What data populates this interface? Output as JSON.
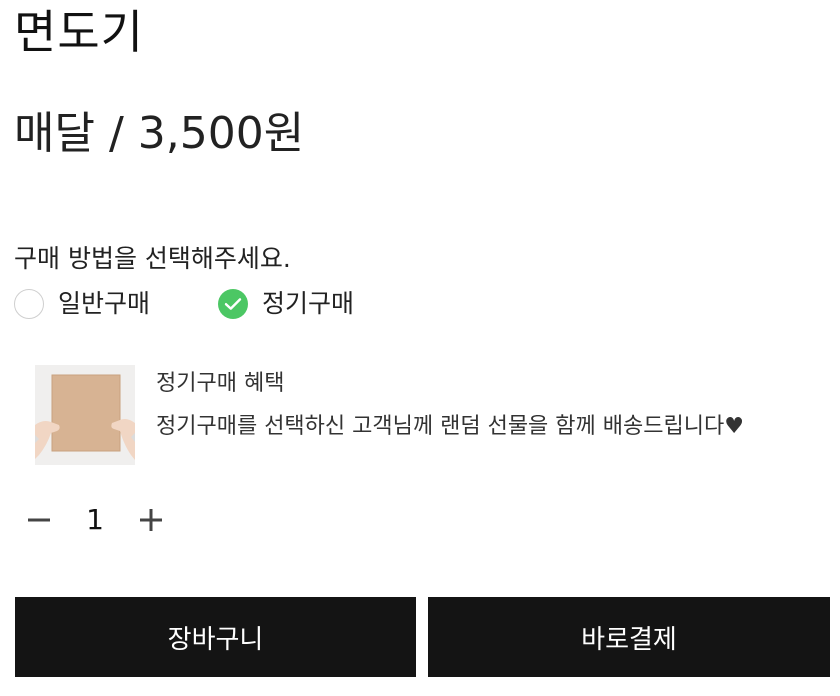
{
  "product": {
    "title": "면도기",
    "price_text": "매달 / 3,500원"
  },
  "purchase_method": {
    "label": "구매 방법을 선택해주세요.",
    "options": [
      {
        "label": "일반구매",
        "selected": false
      },
      {
        "label": "정기구매",
        "selected": true
      }
    ],
    "selected_color": "#4cc764"
  },
  "benefit": {
    "title": "정기구매 혜택",
    "description": "정기구매를 선택하신 고객님께 랜덤 선물을 함께 배송드립니다♥",
    "image": "hands-holding-box-image"
  },
  "quantity": {
    "value": "1",
    "minus_icon": "minus-icon",
    "plus_icon": "plus-icon"
  },
  "actions": {
    "cart_label": "장바구니",
    "buy_label": "바로결제",
    "button_color": "#141414"
  }
}
